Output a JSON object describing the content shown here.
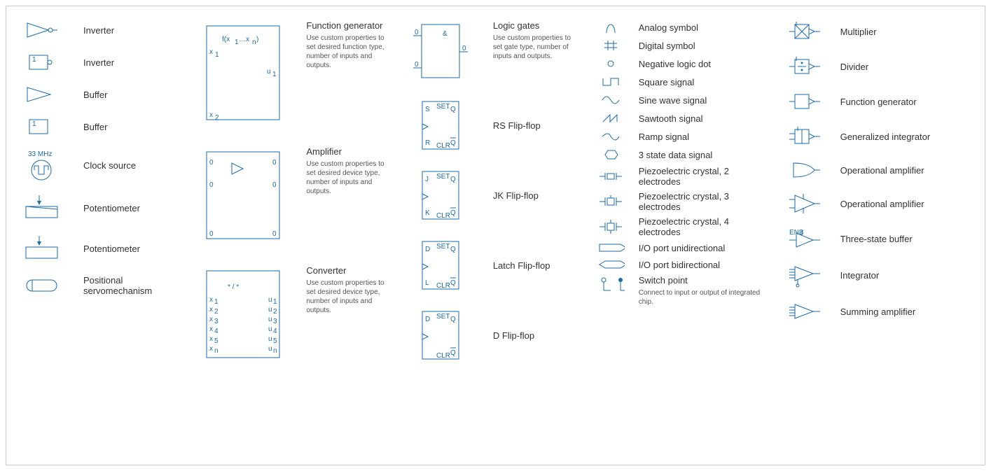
{
  "col1": {
    "inverter1": "Inverter",
    "inverter2": "Inverter",
    "buffer1": "Buffer",
    "buffer2": "Buffer",
    "clock_source": "Clock source",
    "clock_freq": "33 MHz",
    "potentiometer1": "Potentiometer",
    "potentiometer2": "Potentiometer",
    "positional_servo": "Positional servomechanism"
  },
  "col2": {
    "function_generator": {
      "title": "Function generator",
      "desc": "Use custom properties to set desired function type, number of inputs and outputs."
    },
    "amplifier": {
      "title": "Amplifier",
      "desc": "Use custom properties to set desired device type, number of inputs and outputs."
    },
    "converter": {
      "title": "Converter",
      "desc": "Use custom properties to set desired device type, number of inputs and outputs."
    }
  },
  "col3": {
    "logic_gates": {
      "title": "Logic gates",
      "desc": "Use custom properties to set gate type, number of inputs and outputs."
    },
    "rs_flipflop": "RS Flip-flop",
    "jk_flipflop": "JK Flip-flop",
    "latch_flipflop": "Latch Flip-flop",
    "d_flipflop": "D Flip-flop"
  },
  "col4": {
    "analog_symbol": "Analog symbol",
    "digital_symbol": "Digital symbol",
    "negative_logic_dot": "Negative logic dot",
    "square_signal": "Square signal",
    "sine_wave_signal": "Sine wave signal",
    "sawtooth_signal": "Sawtooth signal",
    "ramp_signal": "Ramp signal",
    "three_state_data": "3 state data signal",
    "piezo_2": "Piezoelectric crystal, 2 electrodes",
    "piezo_3": "Piezoelectric crystal, 3 electrodes",
    "piezo_4": "Piezoelectric crystal, 4 electrodes",
    "io_uni": "I/O port unidirectional",
    "io_bi": "I/O port bidirectional",
    "switch_point": {
      "title": "Switch point",
      "desc": "Connect to input or output of integrated chip."
    }
  },
  "col5": {
    "multiplier": "Multiplier",
    "divider": "Divider",
    "function_generator": "Function generator",
    "generalized_integrator": "Generalized integrator",
    "operational_amplifier1": "Operational amplifier",
    "operational_amplifier2": "Operational amplifier",
    "three_state_buffer": "Three-state buffer",
    "integrator": "Integrator",
    "summing_amplifier": "Summing amplifier"
  }
}
